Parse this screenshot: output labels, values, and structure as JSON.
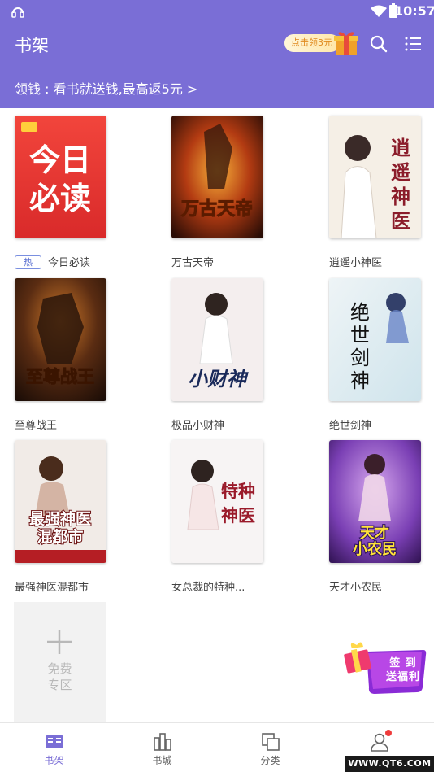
{
  "status_bar": {
    "time": "10:57"
  },
  "header": {
    "title": "书架",
    "gift_pill": "点击领3元",
    "promo": "领钱 : 看书就送钱,最高返5元 >"
  },
  "books": [
    {
      "name": "今日必读",
      "badge": "热",
      "cover_text": "今日\n必读"
    },
    {
      "name": "万古天帝",
      "cover_text": "万古天帝"
    },
    {
      "name": "逍遥小神医",
      "cover_text": "逍遥神医"
    },
    {
      "name": "至尊战王",
      "cover_text": "至尊战王"
    },
    {
      "name": "极品小财神",
      "cover_text": "小财神"
    },
    {
      "name": "绝世剑神",
      "cover_text": "绝世剑神"
    },
    {
      "name": "最强神医混都市",
      "cover_text": "最强神医混都市"
    },
    {
      "name": "女总裁的特种...",
      "cover_text": "特种神医"
    },
    {
      "name": "天才小农民",
      "cover_text": "天才小农民"
    }
  ],
  "free_zone": {
    "label_1": "免费",
    "label_2": "专区"
  },
  "signin_badge": {
    "line_1": "签 到",
    "line_2": "送福利"
  },
  "bottom_nav": [
    {
      "label": "书架",
      "icon": "bookshelf-icon",
      "active": true
    },
    {
      "label": "书城",
      "icon": "bookstore-icon",
      "active": false
    },
    {
      "label": "分类",
      "icon": "category-icon",
      "active": false
    },
    {
      "label": "",
      "icon": "profile-icon",
      "active": false
    }
  ],
  "watermark": "WWW.QT6.COM",
  "colors": {
    "accent": "#7a6ed6",
    "hot_tag": "#5a6fd0",
    "notify_dot": "#ef3b3b"
  }
}
